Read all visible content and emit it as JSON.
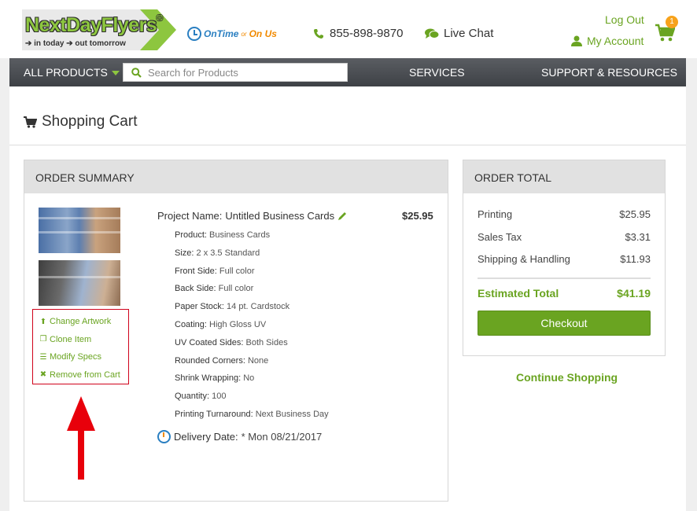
{
  "header": {
    "logo_name": "NextDayFlyers",
    "logo_tagline": "➔ in today ➔ out tomorrow",
    "ontime_a": "OnTime",
    "ontime_or": "or",
    "ontime_b": "On Us",
    "phone": "855-898-9870",
    "live_chat": "Live Chat",
    "log_out": "Log Out",
    "my_account": "My Account",
    "cart_count": "1"
  },
  "nav": {
    "all_products": "ALL PRODUCTS",
    "search_placeholder": "Search for Products",
    "services": "SERVICES",
    "support": "SUPPORT & RESOURCES"
  },
  "page": {
    "title": "Shopping Cart"
  },
  "summary": {
    "heading": "ORDER SUMMARY",
    "actions": [
      {
        "icon": "upload-icon",
        "label": "Change Artwork"
      },
      {
        "icon": "clone-icon",
        "label": "Clone Item"
      },
      {
        "icon": "list-icon",
        "label": "Modify Specs"
      },
      {
        "icon": "close-icon",
        "label": "Remove from Cart"
      }
    ],
    "project_label": "Project Name:",
    "project_name": "Untitled Business Cards",
    "price": "$25.95",
    "specs": [
      {
        "key": "Product:",
        "value": "Business Cards"
      },
      {
        "key": "Size:",
        "value": "2 x 3.5 Standard"
      },
      {
        "key": "Front Side:",
        "value": "Full color"
      },
      {
        "key": "Back Side:",
        "value": "Full color"
      },
      {
        "key": "Paper Stock:",
        "value": "14 pt. Cardstock"
      },
      {
        "key": "Coating:",
        "value": "High Gloss UV"
      },
      {
        "key": "UV Coated Sides:",
        "value": "Both Sides"
      },
      {
        "key": "Rounded Corners:",
        "value": "None"
      },
      {
        "key": "Shrink Wrapping:",
        "value": "No"
      },
      {
        "key": "Quantity:",
        "value": "100"
      },
      {
        "key": "Printing Turnaround:",
        "value": "Next Business Day"
      }
    ],
    "delivery_label": "Delivery Date:",
    "delivery_value": "* Mon 08/21/2017"
  },
  "total": {
    "heading": "ORDER TOTAL",
    "lines": [
      {
        "label": "Printing",
        "value": "$25.95"
      },
      {
        "label": "Sales Tax",
        "value": "$3.31"
      },
      {
        "label": "Shipping & Handling",
        "value": "$11.93"
      }
    ],
    "estimated_label": "Estimated Total",
    "estimated_value": "$41.19",
    "checkout": "Checkout",
    "continue": "Continue Shopping"
  },
  "colors": {
    "brand_green": "#6aa421",
    "nav_dark": "#44474c",
    "annotation_red": "#e8000b"
  }
}
